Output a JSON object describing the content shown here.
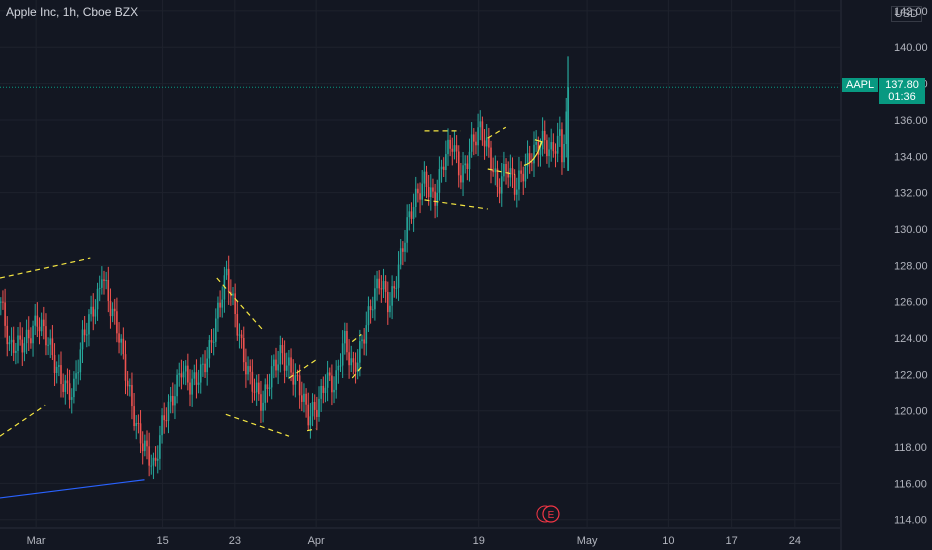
{
  "header": {
    "title": "Apple Inc, 1h, Cboe BZX",
    "currency": "USD"
  },
  "price_tag": {
    "symbol": "AAPL",
    "price": "137.80",
    "countdown": "01:36"
  },
  "colors": {
    "background": "#131722",
    "grid": "#1e222d",
    "axis_text": "#b2b5be",
    "up": "#26a69a",
    "down": "#ef5350",
    "annotation": "#f5e642",
    "trendline": "#2962ff",
    "price_line": "#089981",
    "earnings": "#f23645"
  },
  "chart_data": {
    "type": "candlestick",
    "y_axis": {
      "ticks": [
        114,
        116,
        118,
        120,
        122,
        124,
        126,
        128,
        130,
        132,
        134,
        136,
        138,
        140,
        142
      ],
      "tick_labels": [
        "114.00",
        "116.00",
        "118.00",
        "120.00",
        "122.00",
        "124.00",
        "126.00",
        "128.00",
        "130.00",
        "132.00",
        "134.00",
        "136.00",
        "138.00",
        "140.00",
        "142.00"
      ],
      "range": [
        113.6,
        142.6
      ]
    },
    "x_axis": {
      "labels": [
        "Mar",
        "15",
        "23",
        "Apr",
        "19",
        "May",
        "10",
        "17",
        "24"
      ],
      "label_dates": [
        "2021-03-01",
        "2021-03-15",
        "2021-03-23",
        "2021-04-01",
        "2021-04-19",
        "2021-05-01",
        "2021-05-10",
        "2021-05-17",
        "2021-05-24"
      ],
      "range": [
        "2021-02-25",
        "2021-05-29"
      ]
    },
    "last_price": 137.8,
    "price_path": [
      [
        "2021-02-25",
        126.0
      ],
      [
        "2021-02-26",
        123.0
      ],
      [
        "2021-03-01",
        125.0
      ],
      [
        "2021-03-03",
        122.5
      ],
      [
        "2021-03-05",
        121.0
      ],
      [
        "2021-03-06",
        123.5
      ],
      [
        "2021-03-08",
        127.0
      ],
      [
        "2021-03-08",
        128.6
      ],
      [
        "2021-03-09",
        126.0
      ],
      [
        "2021-03-10",
        124.0
      ],
      [
        "2021-03-11",
        121.5
      ],
      [
        "2021-03-12",
        119.5
      ],
      [
        "2021-03-13",
        118.0
      ],
      [
        "2021-03-14",
        116.4
      ],
      [
        "2021-03-15",
        119.5
      ],
      [
        "2021-03-16",
        121.0
      ],
      [
        "2021-03-17",
        122.5
      ],
      [
        "2021-03-18",
        121.0
      ],
      [
        "2021-03-19",
        121.8
      ],
      [
        "2021-03-20",
        123.5
      ],
      [
        "2021-03-21",
        125.5
      ],
      [
        "2021-03-22",
        127.2
      ],
      [
        "2021-03-23",
        125.0
      ],
      [
        "2021-03-24",
        123.0
      ],
      [
        "2021-03-25",
        121.5
      ],
      [
        "2021-03-26",
        120.0
      ],
      [
        "2021-03-27",
        122.0
      ],
      [
        "2021-03-28",
        123.5
      ],
      [
        "2021-03-29",
        122.5
      ],
      [
        "2021-03-30",
        121.0
      ],
      [
        "2021-03-31",
        119.5
      ],
      [
        "2021-04-01",
        120.5
      ],
      [
        "2021-04-02",
        122.0
      ],
      [
        "2021-04-03",
        121.0
      ],
      [
        "2021-04-04",
        123.8
      ],
      [
        "2021-04-05",
        122.5
      ],
      [
        "2021-04-06",
        124.0
      ],
      [
        "2021-04-07",
        125.5
      ],
      [
        "2021-04-08",
        127.0
      ],
      [
        "2021-04-09",
        126.0
      ],
      [
        "2021-04-10",
        128.0
      ],
      [
        "2021-04-11",
        130.0
      ],
      [
        "2021-04-12",
        131.5
      ],
      [
        "2021-04-13",
        133.0
      ],
      [
        "2021-04-14",
        131.8
      ],
      [
        "2021-04-15",
        133.5
      ],
      [
        "2021-04-16",
        134.5
      ],
      [
        "2021-04-17",
        133.0
      ],
      [
        "2021-04-18",
        134.8
      ],
      [
        "2021-04-19",
        135.3
      ],
      [
        "2021-04-20",
        134.0
      ],
      [
        "2021-04-21",
        132.5
      ],
      [
        "2021-04-22",
        133.8
      ],
      [
        "2021-04-23",
        132.0
      ],
      [
        "2021-04-24",
        133.0
      ],
      [
        "2021-04-25",
        134.5
      ],
      [
        "2021-04-26",
        135.2
      ],
      [
        "2021-04-27",
        134.0
      ],
      [
        "2021-04-28",
        134.8
      ],
      [
        "2021-04-28",
        133.2
      ],
      [
        "2021-04-29",
        137.8
      ]
    ],
    "spike": {
      "date": "2021-04-29",
      "high": 139.5,
      "low": 133.2
    },
    "annotations": [
      {
        "type": "dashed-line",
        "from": [
          "2021-02-25",
          127.3
        ],
        "to": [
          "2021-03-07",
          128.4
        ]
      },
      {
        "type": "dashed-line",
        "from": [
          "2021-02-25",
          118.6
        ],
        "to": [
          "2021-03-02",
          120.3
        ]
      },
      {
        "type": "solid-line",
        "from": [
          "2021-02-25",
          115.2
        ],
        "to": [
          "2021-03-13",
          116.2
        ]
      },
      {
        "type": "dashed-line",
        "from": [
          "2021-03-21",
          127.3
        ],
        "to": [
          "2021-03-26",
          124.5
        ]
      },
      {
        "type": "dashed-line",
        "from": [
          "2021-03-22",
          119.8
        ],
        "to": [
          "2021-03-29",
          118.6
        ]
      },
      {
        "type": "dashed-line",
        "from": [
          "2021-03-29",
          121.8
        ],
        "to": [
          "2021-04-01",
          122.8
        ]
      },
      {
        "type": "dashed-line",
        "from": [
          "2021-03-31",
          118.9
        ],
        "to": [
          "2021-04-01",
          119.0
        ]
      },
      {
        "type": "dashed-line",
        "from": [
          "2021-04-05",
          123.8
        ],
        "to": [
          "2021-04-06",
          124.2
        ]
      },
      {
        "type": "dashed-line",
        "from": [
          "2021-04-05",
          121.8
        ],
        "to": [
          "2021-04-06",
          122.4
        ]
      },
      {
        "type": "dashed-line",
        "from": [
          "2021-04-13",
          135.4
        ],
        "to": [
          "2021-04-17",
          135.4
        ]
      },
      {
        "type": "dashed-line",
        "from": [
          "2021-04-13",
          131.6
        ],
        "to": [
          "2021-04-20",
          131.1
        ]
      },
      {
        "type": "dashed-line",
        "from": [
          "2021-04-20",
          135.0
        ],
        "to": [
          "2021-04-22",
          135.6
        ]
      },
      {
        "type": "dashed-line",
        "from": [
          "2021-04-20",
          133.3
        ],
        "to": [
          "2021-04-23",
          133.0
        ]
      },
      {
        "type": "arrow",
        "from": [
          "2021-04-24",
          133.5
        ],
        "to": [
          "2021-04-26",
          134.8
        ]
      }
    ],
    "event_markers": [
      {
        "date": "2021-04-27",
        "label": "E"
      }
    ],
    "grid": true
  }
}
